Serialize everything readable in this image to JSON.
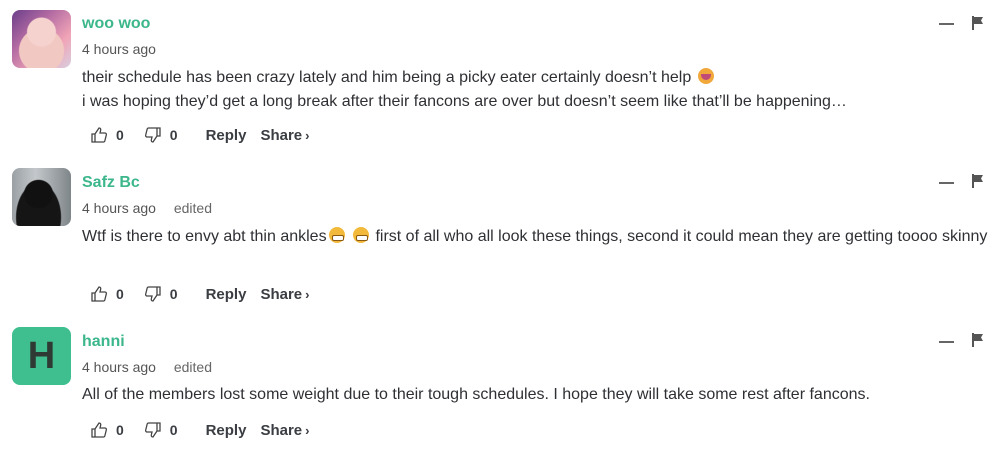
{
  "comments": [
    {
      "author": "woo woo",
      "time": "4 hours ago",
      "edited": "",
      "text_lines": [
        "their schedule has been crazy lately and him being a picky eater certainly doesn’t help",
        "i was hoping they’d get a long break after their fancons are over but doesn’t seem like that’ll be happening…"
      ],
      "likes": "0",
      "dislikes": "0",
      "reply": "Reply",
      "share": "Share"
    },
    {
      "author": "Safz Bc",
      "time": "4 hours ago",
      "edited": "edited",
      "text_part1": "Wtf is there to envy abt thin ankles",
      "text_part2": " first of all who all look these things, second it could mean they are getting toooo skinny",
      "likes": "0",
      "dislikes": "0",
      "reply": "Reply",
      "share": "Share"
    },
    {
      "author": "hanni",
      "avatar_letter": "H",
      "time": "4 hours ago",
      "edited": "edited",
      "text": "All of the members lost some weight due to their tough schedules. I hope they will take some rest after fancons.",
      "likes": "0",
      "dislikes": "0",
      "reply": "Reply",
      "share": "Share"
    }
  ],
  "icons": {
    "like": "thumbs-up-icon",
    "dislike": "thumbs-down-icon",
    "collapse": "minus-icon",
    "flag": "flag-icon",
    "share_chevron": "›"
  },
  "colors": {
    "author": "#3cb78b",
    "avatar_letter_bg": "#3fbf8f"
  }
}
